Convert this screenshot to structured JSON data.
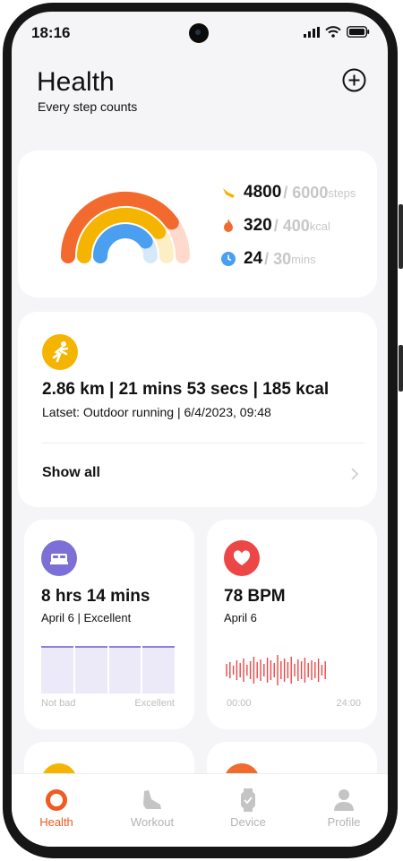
{
  "status_bar": {
    "time": "18:16"
  },
  "header": {
    "title": "Health",
    "subtitle": "Every step counts"
  },
  "activity": {
    "steps": {
      "value": "4800",
      "goal": "/ 6000",
      "unit": "steps",
      "progress": 0.8
    },
    "calories": {
      "value": "320",
      "goal": "/ 400",
      "unit": "kcal",
      "progress": 0.8
    },
    "minutes": {
      "value": "24",
      "goal": "/ 30",
      "unit": "mins",
      "progress": 0.8
    }
  },
  "workout": {
    "summary": "2.86 km | 21 mins 53 secs | 185 kcal",
    "latest": "Latset: Outdoor running | 6/4/2023, 09:48",
    "show_all_label": "Show all"
  },
  "sleep": {
    "value": "8 hrs 14 mins",
    "sub": "April 6 | Excellent",
    "axis_left": "Not bad",
    "axis_right": "Excellent"
  },
  "heart": {
    "value": "78 BPM",
    "sub": "April 6",
    "axis_left": "00:00",
    "axis_right": "24:00"
  },
  "tabs": [
    {
      "label": "Health",
      "icon": "health-ring-icon",
      "active": true
    },
    {
      "label": "Workout",
      "icon": "shoe-icon",
      "active": false
    },
    {
      "label": "Device",
      "icon": "watch-icon",
      "active": false
    },
    {
      "label": "Profile",
      "icon": "person-icon",
      "active": false
    }
  ],
  "colors": {
    "accent": "#f15a22",
    "steps": "#f5b400",
    "calories": "#f26a2e",
    "minutes": "#4a9ff0",
    "sleep": "#7c6fd6",
    "heart": "#ec4646"
  }
}
